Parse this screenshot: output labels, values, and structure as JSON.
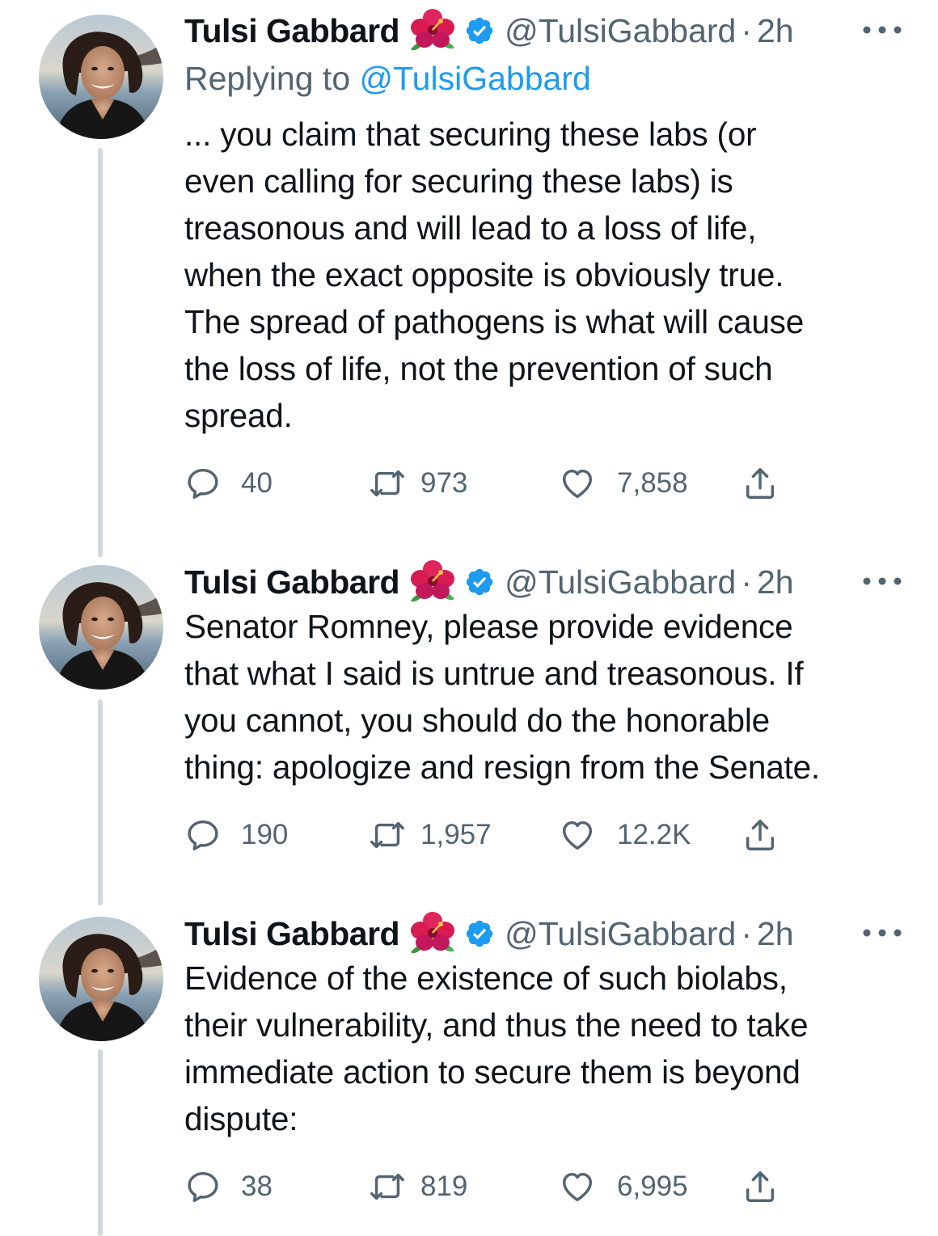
{
  "tweets": [
    {
      "name": "Tulsi Gabbard",
      "handle": "@TulsiGabbard",
      "separator": "·",
      "time": "2h",
      "replying_prefix": "Replying to",
      "replying_to": "@TulsiGabbard",
      "text": "... you claim that securing these labs (or\neven calling for securing these labs) is\ntreasonous and will lead to a loss of life,\nwhen the exact opposite is obviously true.\nThe spread of pathogens is what will cause\nthe loss of life, not the prevention of such\nspread.",
      "replies": "40",
      "retweets": "973",
      "likes": "7,858"
    },
    {
      "name": "Tulsi Gabbard",
      "handle": "@TulsiGabbard",
      "separator": "·",
      "time": "2h",
      "text": "Senator Romney, please provide evidence\nthat what I said is untrue and treasonous. If\nyou cannot, you should do the honorable\nthing: apologize and resign from the Senate.",
      "replies": "190",
      "retweets": "1,957",
      "likes": "12.2K"
    },
    {
      "name": "Tulsi Gabbard",
      "handle": "@TulsiGabbard",
      "separator": "·",
      "time": "2h",
      "text": "Evidence of the existence of such biolabs,\ntheir vulnerability, and thus the need to take\nimmediate action to secure them is beyond\ndispute:",
      "replies": "38",
      "retweets": "819",
      "likes": "6,995"
    }
  ],
  "icons": {
    "name_emoji": "hibiscus-icon",
    "badge": "verified-badge-icon",
    "more": "more-options-icon",
    "reply": "reply-icon",
    "retweet": "retweet-icon",
    "like": "like-icon",
    "share": "share-icon"
  },
  "colors": {
    "text": "#0f1419",
    "secondary": "#536471",
    "accent": "#1d9bf0",
    "thread_line": "#cfd9de"
  }
}
